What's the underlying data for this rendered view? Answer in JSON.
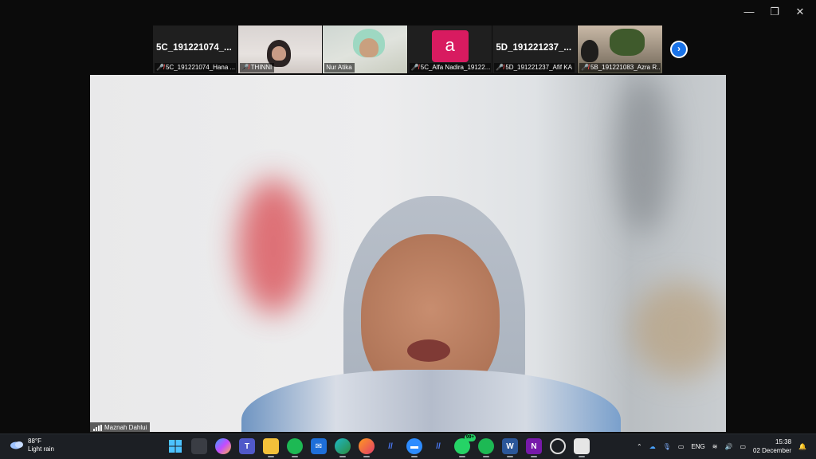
{
  "window": {
    "minimize": "—",
    "restore": "❐",
    "close": "✕"
  },
  "thumbnails": [
    {
      "big_name": "5C_191221074_...",
      "label": "5C_191221074_Hana ...",
      "mic_muted": true,
      "type": "name-only"
    },
    {
      "big_name": "",
      "label": "THINNI",
      "mic_muted": true,
      "type": "video"
    },
    {
      "big_name": "",
      "label": "Nur Atika",
      "mic_muted": false,
      "type": "video"
    },
    {
      "big_name": "",
      "avatar_letter": "a",
      "label": "5C_Alfa Nadira_19122...",
      "mic_muted": true,
      "type": "avatar"
    },
    {
      "big_name": "5D_191221237_...",
      "label": "5D_191221237_Afif KA",
      "mic_muted": true,
      "type": "name-only"
    },
    {
      "big_name": "",
      "label": "5B_191221083_Azra R...",
      "mic_muted": true,
      "type": "video"
    }
  ],
  "next_page_icon": "chevron-right-icon",
  "speaker": {
    "name": "Maznah Dahlui"
  },
  "taskbar": {
    "weather_temp": "88°F",
    "weather_desc": "Light rain",
    "whatsapp_badge": "99+",
    "language": "ENG",
    "time": "15:38",
    "date": "02 December"
  },
  "colors": {
    "accent_blue": "#1a73e8",
    "avatar_pink": "#d81b60",
    "muted_red": "#ff4b4b",
    "taskbar_bg": "#1c1f24"
  }
}
